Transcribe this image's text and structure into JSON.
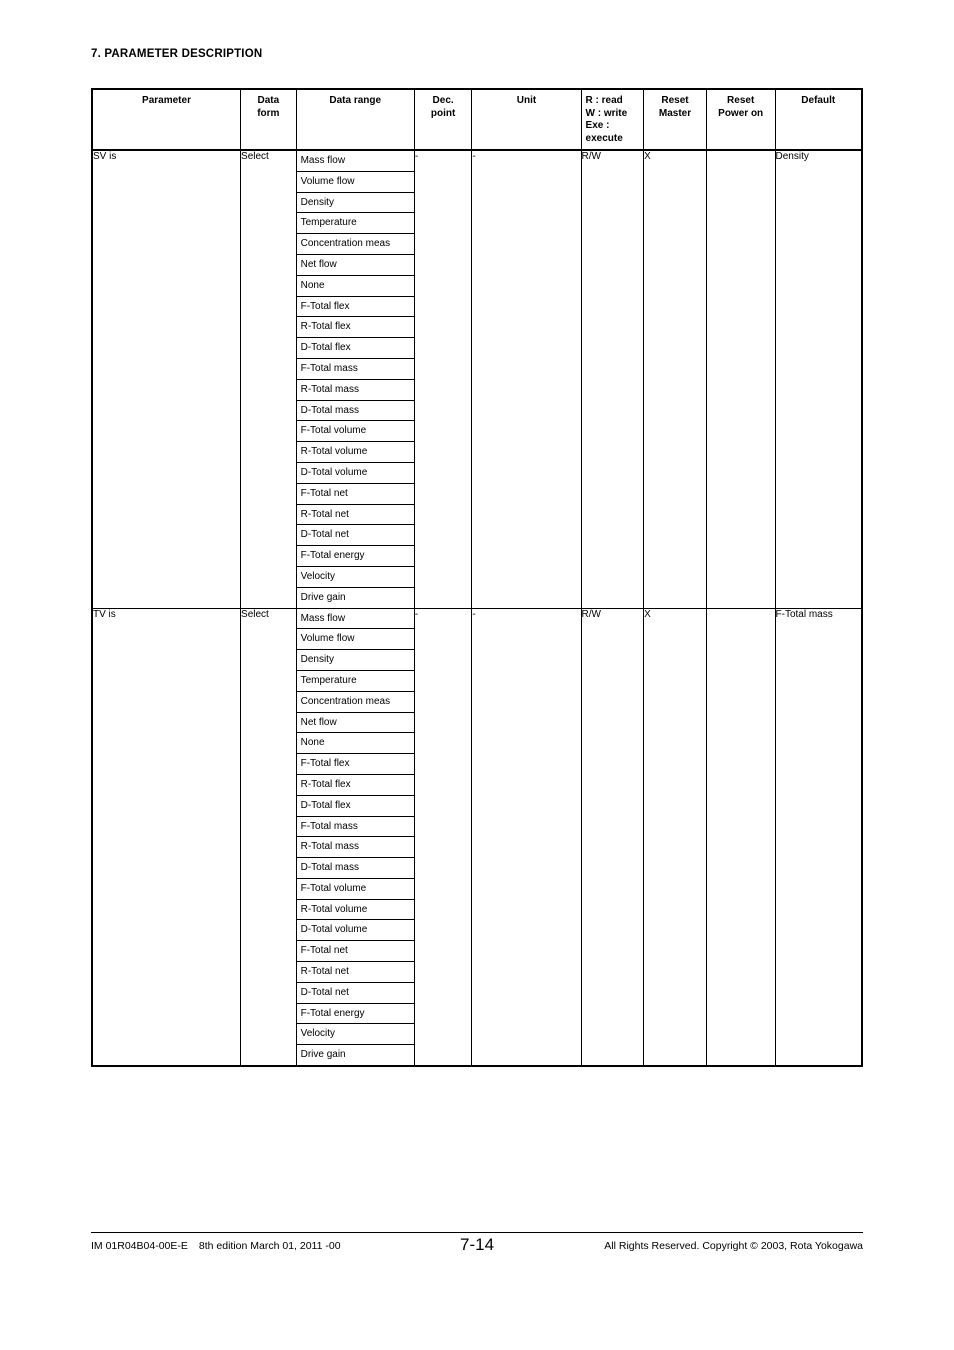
{
  "document": {
    "section_title": "7. PARAMETER DESCRIPTION"
  },
  "table": {
    "headers": {
      "parameter": "Parameter",
      "data_form": "Data\nform",
      "data_form_line1": "Data",
      "data_form_line2": "form",
      "data_range": "Data range",
      "dec_point_line1": "Dec.",
      "dec_point_line2": "point",
      "unit": "Unit",
      "rw_line1": "R : read",
      "rw_line2": "W : write",
      "rw_line3": "Exe :",
      "rw_line4": "execute",
      "reset_master_line1": "Reset",
      "reset_master_line2": "Master",
      "reset_power_line1": "Reset",
      "reset_power_line2": "Power on",
      "default": "Default"
    },
    "blocks": [
      {
        "parameter": "SV is",
        "data_form": "Select",
        "data_range": [
          "Mass flow",
          "Volume flow",
          "Density",
          "Temperature",
          "Concentration meas",
          "Net flow",
          "None",
          "F-Total flex",
          "R-Total flex",
          "D-Total flex",
          "F-Total mass",
          "R-Total mass",
          "D-Total mass",
          "F-Total volume",
          "R-Total volume",
          "D-Total volume",
          "F-Total net",
          "R-Total net",
          "D-Total net",
          "F-Total energy",
          "Velocity",
          "Drive gain"
        ],
        "dec_point": "-",
        "unit": "-",
        "rw": "R/W",
        "reset_master": "X",
        "reset_power_on": "",
        "default": "Density"
      },
      {
        "parameter": "TV is",
        "data_form": "Select",
        "data_range": [
          "Mass flow",
          "Volume flow",
          "Density",
          "Temperature",
          "Concentration meas",
          "Net flow",
          "None",
          "F-Total flex",
          "R-Total flex",
          "D-Total flex",
          "F-Total mass",
          "R-Total mass",
          "D-Total mass",
          "F-Total volume",
          "R-Total volume",
          "D-Total volume",
          "F-Total net",
          "R-Total net",
          "D-Total net",
          "F-Total energy",
          "Velocity",
          "Drive gain"
        ],
        "dec_point": "-",
        "unit": "-",
        "rw": "R/W",
        "reset_master": "X",
        "reset_power_on": "",
        "default": "F-Total mass"
      }
    ]
  },
  "footer": {
    "document_code": "IM 01R04B04-00E-E",
    "edition": "8th edition March 01, 2011 -00",
    "page_number": "7-14",
    "copyright": "All Rights Reserved. Copyright © 2003, Rota Yokogawa"
  }
}
